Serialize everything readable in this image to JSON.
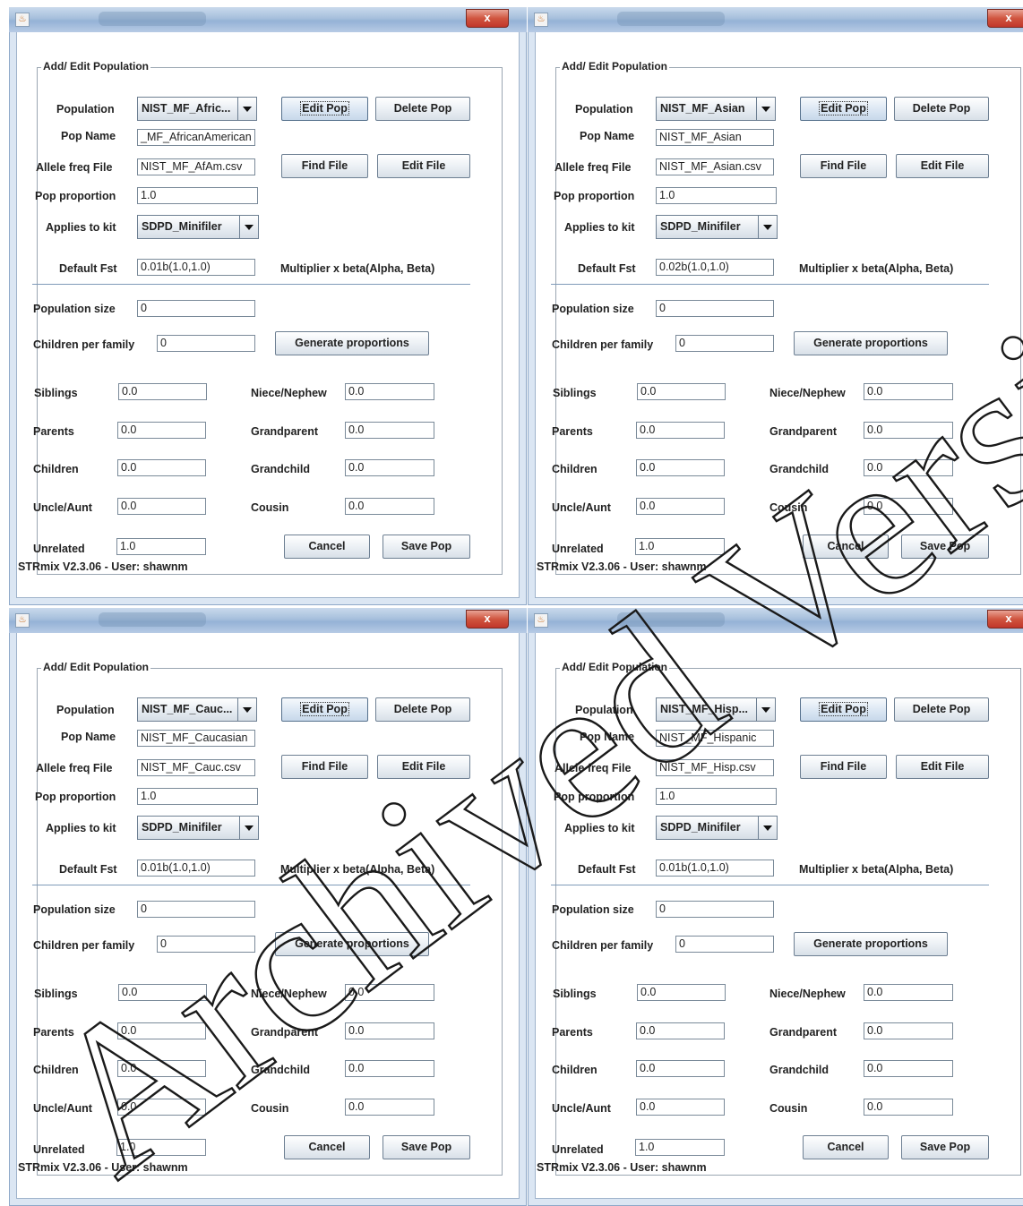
{
  "common": {
    "group_title": "Add/ Edit Population",
    "close_label": "x",
    "labels": {
      "population": "Population",
      "pop_name": "Pop Name",
      "allele_freq_file": "Allele freq  File",
      "pop_proportion": "Pop proportion",
      "applies_to_kit": "Applies to kit",
      "default_fst": "Default Fst",
      "multiplier_note": "Multiplier x beta(Alpha, Beta)",
      "population_size": "Population size",
      "children_per_family": "Children per family",
      "siblings": "Siblings",
      "niece_nephew": "Niece/Nephew",
      "parents": "Parents",
      "grandparent": "Grandparent",
      "children": "Children",
      "grandchild": "Grandchild",
      "uncle_aunt": "Uncle/Aunt",
      "cousin": "Cousin",
      "unrelated": "Unrelated"
    },
    "buttons": {
      "edit_pop": "Edit Pop",
      "delete_pop": "Delete Pop",
      "find_file": "Find File",
      "edit_file": "Edit File",
      "generate_proportions": "Generate proportions",
      "cancel": "Cancel",
      "save_pop": "Save Pop"
    },
    "status_text": "STRmix V2.3.06 - User: shawnm"
  },
  "windows": [
    {
      "population": "NIST_MF_Afric...",
      "pop_name": "_MF_AfricanAmerican",
      "allele_file": "NIST_MF_AfAm.csv",
      "pop_proportion": "1.0",
      "kit": "SDPD_Minifiler",
      "default_fst": "0.01b(1.0,1.0)",
      "population_size": "0",
      "children_per_family": "0",
      "siblings": "0.0",
      "niece_nephew": "0.0",
      "parents": "0.0",
      "grandparent": "0.0",
      "children": "0.0",
      "grandchild": "0.0",
      "uncle_aunt": "0.0",
      "cousin": "0.0",
      "unrelated": "1.0"
    },
    {
      "population": "NIST_MF_Asian",
      "pop_name": "NIST_MF_Asian",
      "allele_file": "NIST_MF_Asian.csv",
      "pop_proportion": "1.0",
      "kit": "SDPD_Minifiler",
      "default_fst": "0.02b(1.0,1.0)",
      "population_size": "0",
      "children_per_family": "0",
      "siblings": "0.0",
      "niece_nephew": "0.0",
      "parents": "0.0",
      "grandparent": "0.0",
      "children": "0.0",
      "grandchild": "0.0",
      "uncle_aunt": "0.0",
      "cousin": "0.0",
      "unrelated": "1.0"
    },
    {
      "population": "NIST_MF_Cauc...",
      "pop_name": "NIST_MF_Caucasian",
      "allele_file": "NIST_MF_Cauc.csv",
      "pop_proportion": "1.0",
      "kit": "SDPD_Minifiler",
      "default_fst": "0.01b(1.0,1.0)",
      "population_size": "0",
      "children_per_family": "0",
      "siblings": "0.0",
      "niece_nephew": "0.0",
      "parents": "0.0",
      "grandparent": "0.0",
      "children": "0.0",
      "grandchild": "0.0",
      "uncle_aunt": "0.0",
      "cousin": "0.0",
      "unrelated": "1.0"
    },
    {
      "population": "NIST_MF_Hisp...",
      "pop_name": "NIST_MF_Hispanic",
      "allele_file": "NIST_MF_Hisp.csv",
      "pop_proportion": "1.0",
      "kit": "SDPD_Minifiler",
      "default_fst": "0.01b(1.0,1.0)",
      "population_size": "0",
      "children_per_family": "0",
      "siblings": "0.0",
      "niece_nephew": "0.0",
      "parents": "0.0",
      "grandparent": "0.0",
      "children": "0.0",
      "grandchild": "0.0",
      "uncle_aunt": "0.0",
      "cousin": "0.0",
      "unrelated": "1.0"
    }
  ],
  "watermark": {
    "text": "Archived Version",
    "color": "#1a1a1a"
  },
  "colors": {
    "titlebar": "#a6bfdc",
    "close": "#c1362a",
    "frame": "#dbe6f3"
  }
}
